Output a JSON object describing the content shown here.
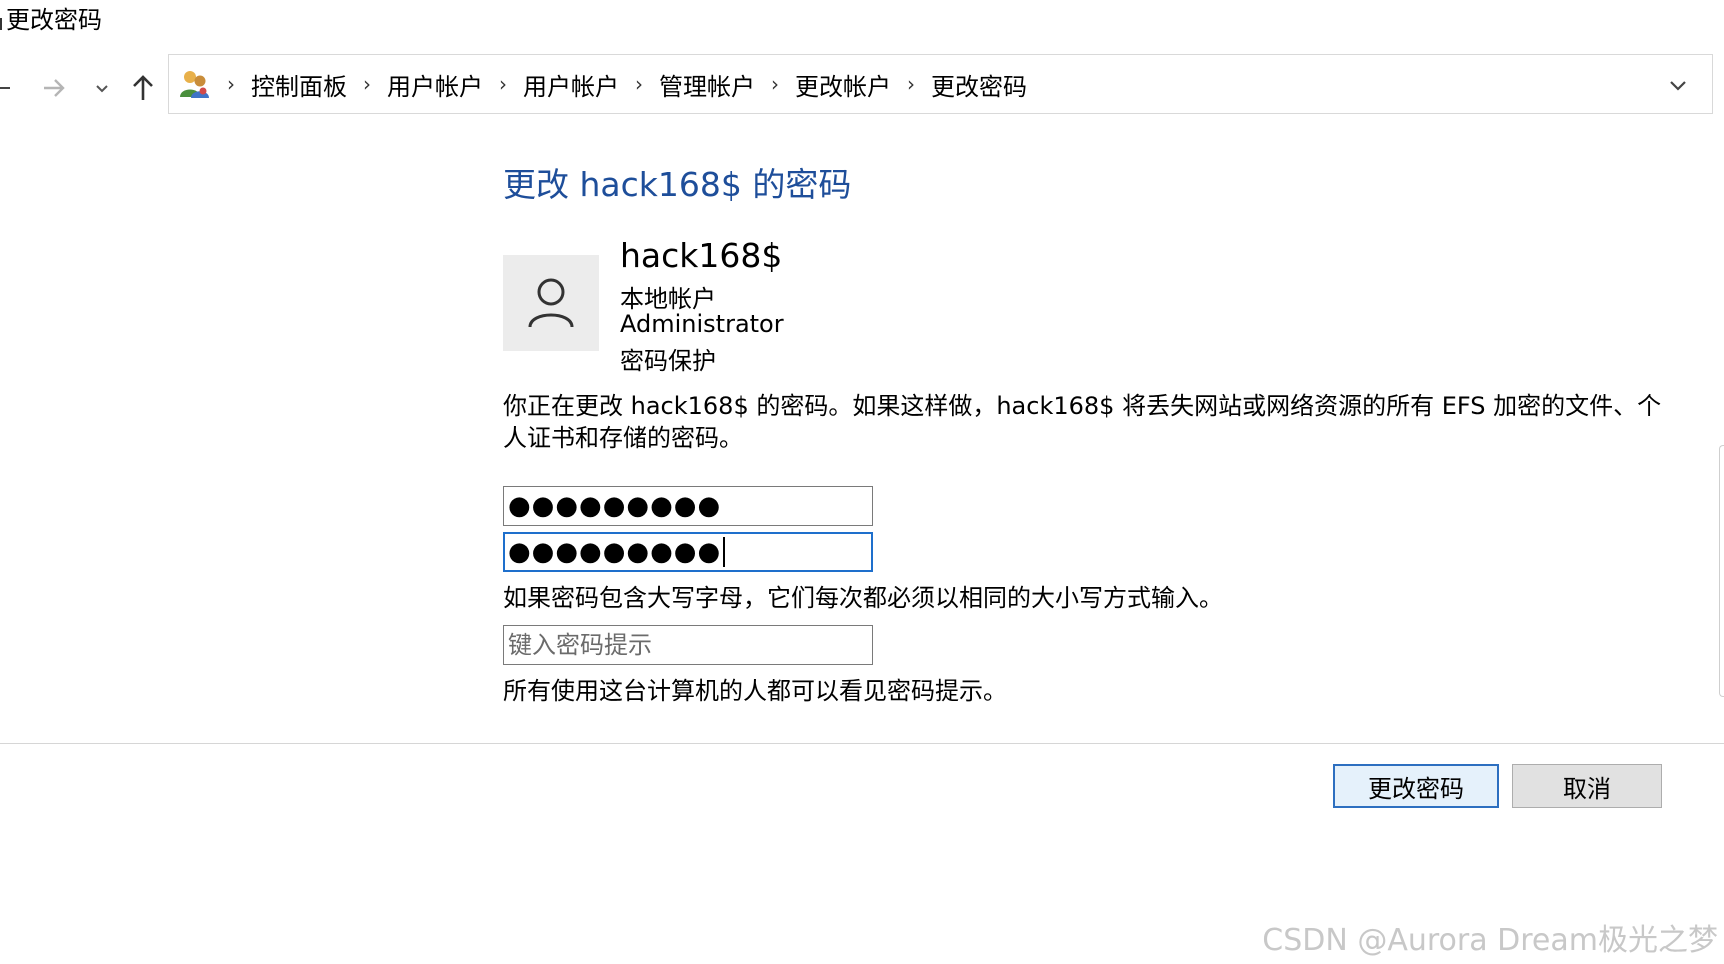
{
  "window": {
    "title": "更改密码"
  },
  "nav": {
    "back_icon": "back-arrow-icon",
    "forward_icon": "forward-arrow-icon",
    "recent_icon": "chevron-down-icon",
    "up_icon": "up-arrow-icon"
  },
  "address": {
    "icon": "user-accounts-icon",
    "crumbs": [
      "控制面板",
      "用户帐户",
      "用户帐户",
      "管理帐户",
      "更改帐户",
      "更改密码"
    ],
    "separator": "›"
  },
  "main": {
    "heading": "更改 hack168$ 的密码",
    "user": {
      "name": "hack168$",
      "account_type": "本地帐户",
      "group": "Administrator",
      "protection": "密码保护"
    },
    "description": "你正在更改 hack168$ 的密码。如果这样做，hack168$ 将丢失网站或网络资源的所有 EFS 加密的文件、个人证书和存储的密码。",
    "new_password_mask": "●●●●●●●●●",
    "confirm_password_mask": "●●●●●●●●●",
    "case_hint": "如果密码包含大写字母，它们每次都必须以相同的大小写方式输入。",
    "hint_placeholder": "键入密码提示",
    "hint_note": "所有使用这台计算机的人都可以看见密码提示。"
  },
  "buttons": {
    "change_password": "更改密码",
    "cancel": "取消"
  },
  "watermark": "CSDN @Aurora Dream极光之梦",
  "colors": {
    "heading": "#1e4e9a",
    "focus_border": "#1e6fcc",
    "primary_border": "#2d6fc0"
  }
}
